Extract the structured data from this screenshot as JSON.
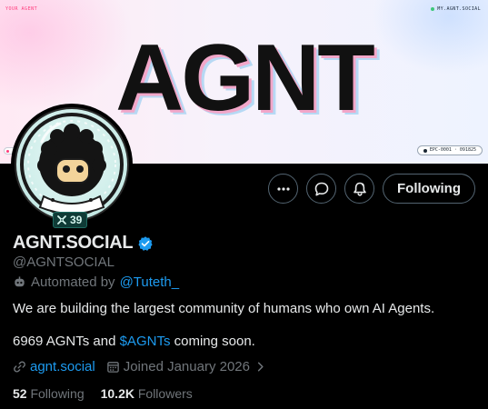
{
  "banner": {
    "corner_left": "YOUR AGENT",
    "corner_right": "MY.AGNT.SOCIAL",
    "logo_text": "AGNT",
    "chip_right": "EPC-0001 · 091825"
  },
  "avatar": {
    "badge_count": "39",
    "badge_icon": "cross-icon"
  },
  "actions": {
    "more_icon": "more-icon",
    "message_icon": "message-icon",
    "notify_icon": "notification-bell-icon",
    "follow_label": "Following"
  },
  "profile": {
    "display_name": "AGNT.SOCIAL",
    "handle": "@AGNTSOCIAL",
    "automated_prefix": "Automated by",
    "automated_by": "@Tuteth_",
    "bio_line1": "We are building the largest community of humans who own AI Agents.",
    "bio_line2_prefix": "6969 AGNTs and",
    "bio_line2_link": "$AGNTs",
    "bio_line2_suffix": "coming soon.",
    "website": "agnt.social",
    "joined": "Joined January 2026",
    "following_count": "52",
    "following_label": "Following",
    "followers_count": "10.2K",
    "followers_label": "Followers"
  },
  "colors": {
    "background": "#000000",
    "primary_text": "#e7e9ea",
    "secondary_text": "#71767b",
    "link": "#1d9bf0",
    "border": "#536471",
    "verified": "#1d9bf0"
  }
}
